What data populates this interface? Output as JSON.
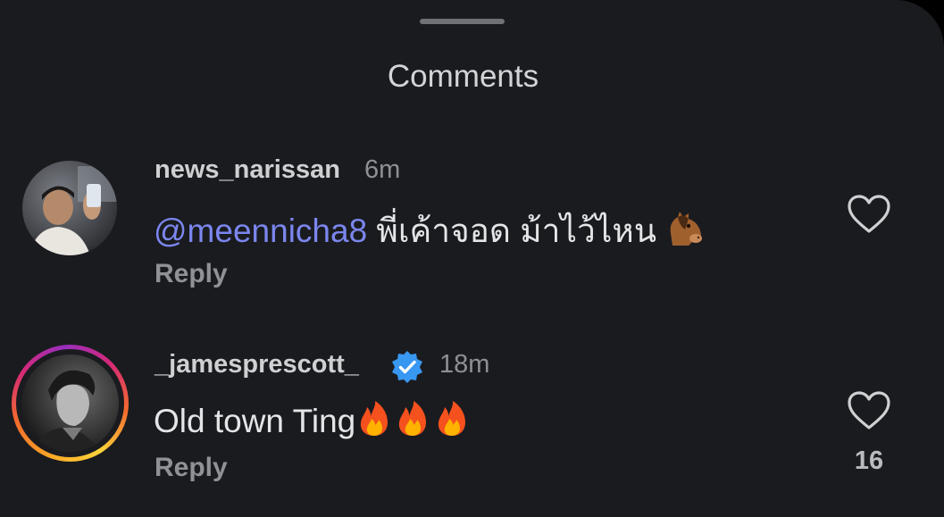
{
  "sheet": {
    "title": "Comments"
  },
  "comments": [
    {
      "username": "news_narissan",
      "time": "6m",
      "mention": "@meennicha8",
      "text": " พี่เค้าจอด ม้าไว้ไหน ",
      "emoji": "horse-face",
      "reply_label": "Reply",
      "likes": "",
      "verified": false
    },
    {
      "username": "_jamesprescott_",
      "time": "18m",
      "mention": "",
      "text": "Old town Ting",
      "emoji": "fire x3",
      "reply_label": "Reply",
      "likes": "16",
      "verified": true
    }
  ],
  "icons": {
    "like": "heart-outline-icon",
    "verified": "verified-badge-icon"
  },
  "colors": {
    "background": "#1a1b1f",
    "mention": "#7b86ee",
    "verified": "#3897f0"
  }
}
